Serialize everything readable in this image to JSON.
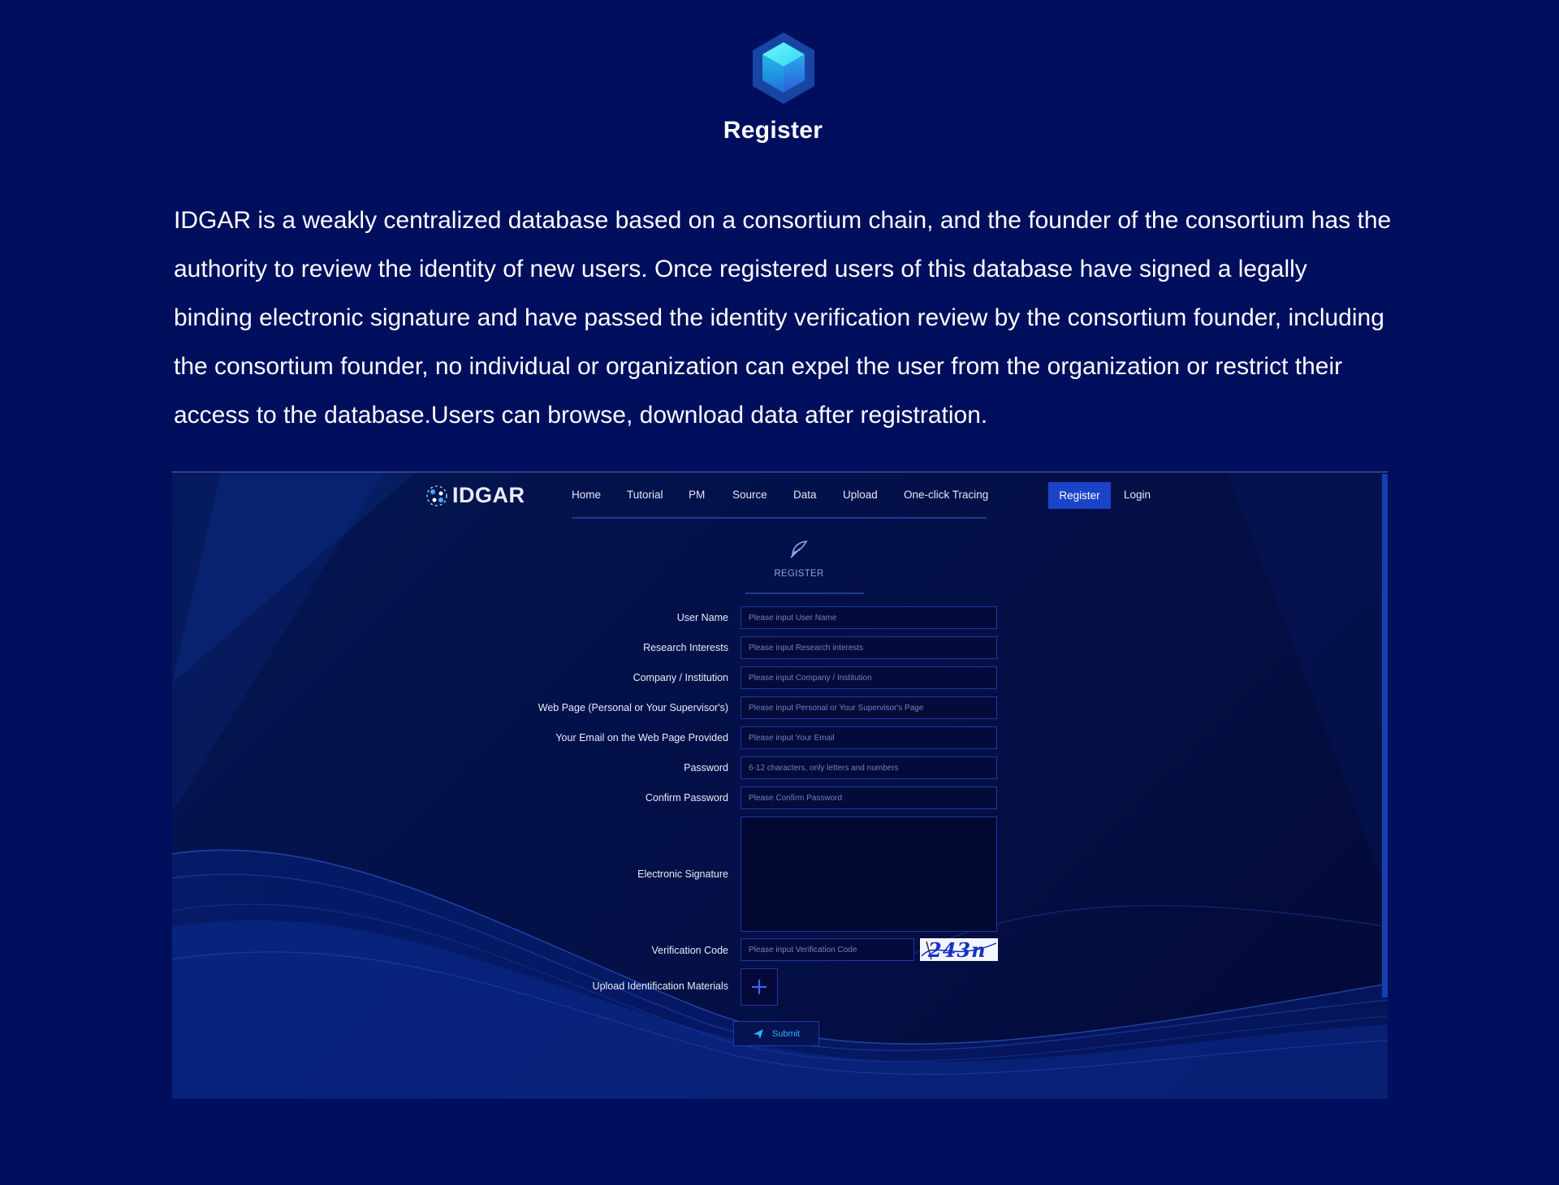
{
  "header": {
    "logo_icon": "hexagon-cube-icon",
    "title": "Register"
  },
  "intro": "IDGAR is a weakly centralized database based on a consortium chain, and the founder of the consortium has the authority to review the identity of new users. Once registered users of this database have signed a legally binding electronic signature and have passed the identity verification review by the consortium founder, including the consortium founder, no individual or organization can expel the user from the organization or restrict their access to the database.Users can browse, download data after registration.",
  "screenshot": {
    "brand": "IDGAR",
    "nav": [
      "Home",
      "Tutorial",
      "PM",
      "Source",
      "Data",
      "Upload",
      "One-click Tracing"
    ],
    "register_button": "Register",
    "login_link": "Login",
    "section_label": "REGISTER",
    "form": {
      "username": {
        "label": "User Name",
        "placeholder": "Please input User Name"
      },
      "research": {
        "label": "Research Interests",
        "placeholder": "Please input Research interests"
      },
      "company": {
        "label": "Company / Institution",
        "placeholder": "Please input Company / Institution"
      },
      "webpage": {
        "label": "Web Page (Personal or Your Supervisor's)",
        "placeholder": "Please input Personal or Your Supervisor's Page"
      },
      "email": {
        "label": "Your Email on the Web Page Provided",
        "placeholder": "Please input Your Email"
      },
      "password": {
        "label": "Password",
        "placeholder": "6-12 characters, only letters and numbers"
      },
      "confirm": {
        "label": "Confirm Password",
        "placeholder": "Please Confirm Password"
      },
      "signature": {
        "label": "Electronic Signature"
      },
      "verification": {
        "label": "Verification Code",
        "placeholder": "Please input Verification Code"
      },
      "captcha": "243n",
      "upload": {
        "label": "Upload Identification Materials"
      }
    },
    "submit_label": "Submit"
  },
  "colors": {
    "page_background": "#000e5e",
    "accent": "#1a43c8",
    "submit_text": "#2ab4ff"
  }
}
